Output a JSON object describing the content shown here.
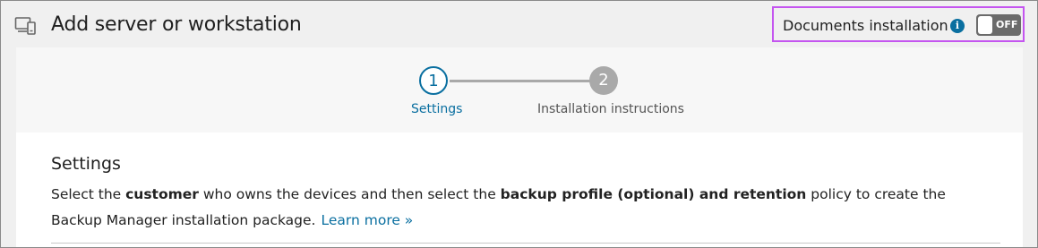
{
  "header": {
    "title": "Add server or workstation",
    "icon": "devices-icon"
  },
  "documents_installation": {
    "label": "Documents installation",
    "info_icon": "info-icon",
    "info_glyph": "i",
    "toggle_state": "OFF"
  },
  "stepper": {
    "steps": [
      {
        "number": "1",
        "label": "Settings",
        "state": "active"
      },
      {
        "number": "2",
        "label": "Installation instructions",
        "state": "inactive"
      }
    ]
  },
  "settings": {
    "title": "Settings",
    "desc_part1": "Select the ",
    "desc_bold1": "customer",
    "desc_part2": " who owns the devices and then select the ",
    "desc_bold2": "backup profile (optional) and retention",
    "desc_part3": " policy to create the Backup Manager installation package.",
    "learn_more": "Learn more »"
  },
  "colors": {
    "accent": "#0a6fa0",
    "highlight_border": "#c455f0",
    "toggle_bg": "#6b6b6b",
    "step_inactive": "#a9a9a9"
  }
}
